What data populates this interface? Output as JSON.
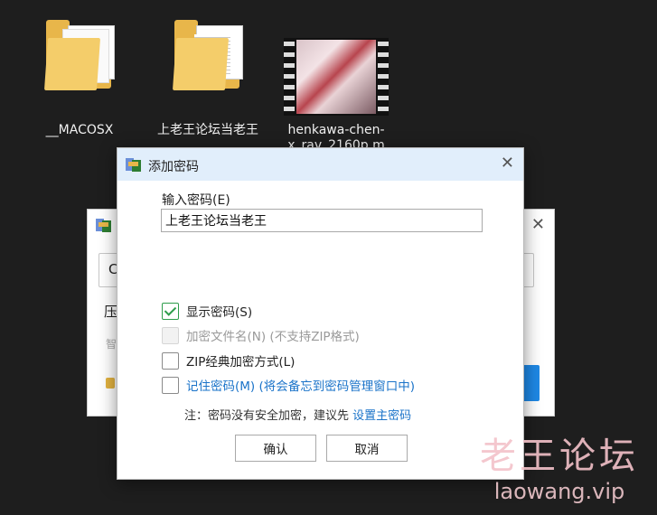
{
  "desktop": {
    "items": [
      {
        "label": "__MACOSX"
      },
      {
        "label": "上老王论坛当老王"
      },
      {
        "label": "henkawa-chen-x_rav_2160p.m"
      }
    ]
  },
  "dialog": {
    "title": "添加密码",
    "password_label": "输入密码(E)",
    "password_value": "上老王论坛当老王",
    "options": {
      "show_password": "显示密码(S)",
      "encrypt_filenames": "加密文件名(N) (不支持ZIP格式)",
      "zip_legacy": "ZIP经典加密方式(L)",
      "remember_password": "记住密码(M) (将会备忘到密码管理窗口中)"
    },
    "note_prefix": "注：密码没有安全加密，建议先 ",
    "note_link": "设置主密码",
    "ok_label": "确认",
    "cancel_label": "取消"
  },
  "under_dialog": {
    "field_fragment": "C",
    "label_fragment1": "压",
    "label_fragment2": "智"
  },
  "watermark": {
    "line1": "老王论坛",
    "line2": "laowang.vip"
  },
  "colors": {
    "accent": "#1a73c9",
    "check": "#2e9d4b",
    "titlebar": "#e1eefb"
  }
}
